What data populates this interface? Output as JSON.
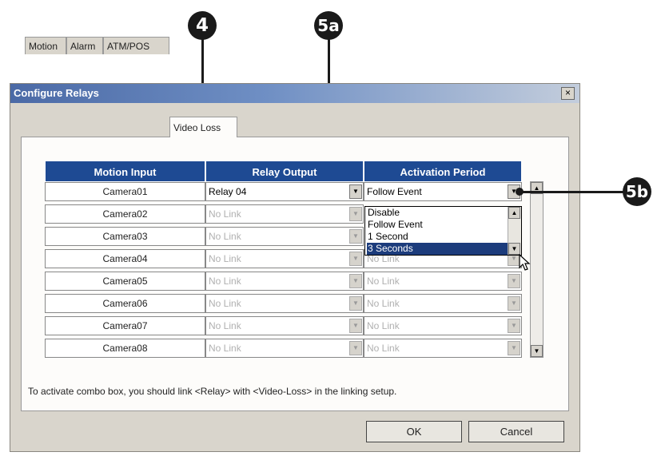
{
  "window": {
    "title": "Configure Relays",
    "close_glyph": "×"
  },
  "tabs": [
    {
      "label": "Motion",
      "active": false
    },
    {
      "label": "Alarm",
      "active": false
    },
    {
      "label": "ATM/POS",
      "active": false
    },
    {
      "label": "Video Loss",
      "active": true
    }
  ],
  "table": {
    "headers": [
      "Motion Input",
      "Relay Output",
      "Activation Period"
    ],
    "rows": [
      {
        "input": "Camera01",
        "relay": "Relay 04",
        "period": "Follow Event"
      },
      {
        "input": "Camera02",
        "relay": "No Link",
        "period": ""
      },
      {
        "input": "Camera03",
        "relay": "No Link",
        "period": ""
      },
      {
        "input": "Camera04",
        "relay": "No Link",
        "period": "No Link"
      },
      {
        "input": "Camera05",
        "relay": "No Link",
        "period": "No Link"
      },
      {
        "input": "Camera06",
        "relay": "No Link",
        "period": "No Link"
      },
      {
        "input": "Camera07",
        "relay": "No Link",
        "period": "No Link"
      },
      {
        "input": "Camera08",
        "relay": "No Link",
        "period": "No Link"
      }
    ]
  },
  "period_dropdown": {
    "options": [
      "Disable",
      "Follow Event",
      "1 Second",
      "3 Seconds"
    ],
    "highlighted": "3 Seconds"
  },
  "note": "To activate combo box, you should link <Relay> with <Video-Loss> in the linking setup.",
  "buttons": {
    "ok": "OK",
    "cancel": "Cancel"
  },
  "callouts": {
    "tab": "4",
    "relay": "5a",
    "period": "5b"
  },
  "colors": {
    "header_bg": "#1e4a93",
    "selection": "#1c3c7c",
    "titlebar_start": "#4b6aa6"
  },
  "icons": {
    "dropdown": "chevron-down-icon",
    "cursor": "mouse-pointer-icon"
  }
}
